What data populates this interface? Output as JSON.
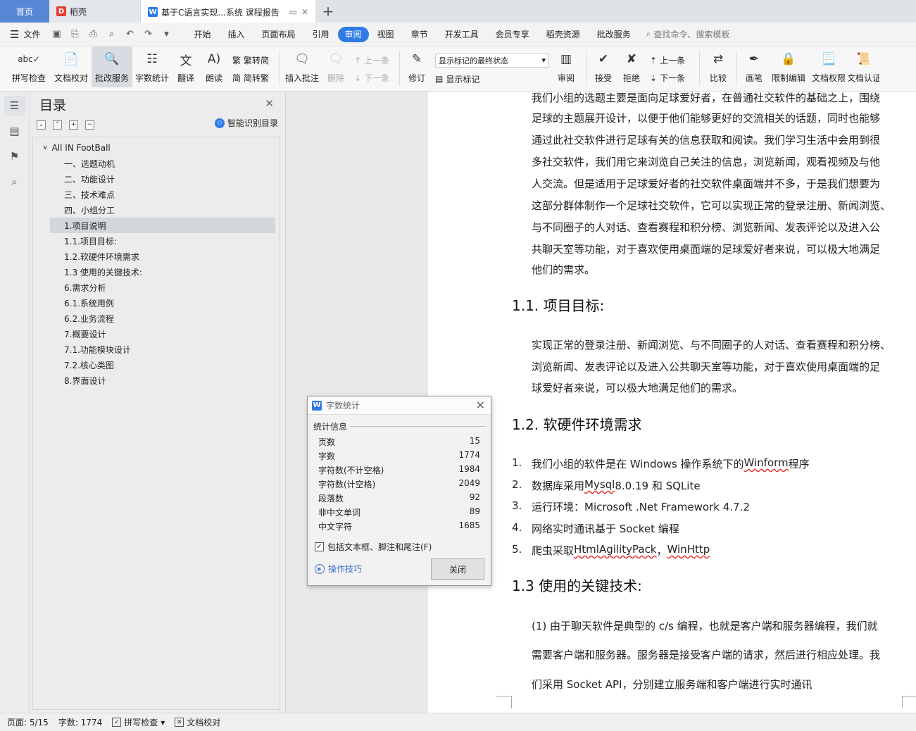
{
  "tabs": {
    "home": "首页",
    "daoke": "稻壳",
    "doc_title": "基于C语言实现...系统 课程报告",
    "add": "+"
  },
  "menubar": {
    "file": "文件",
    "items": [
      "开始",
      "插入",
      "页面布局",
      "引用",
      "审阅",
      "视图",
      "章节",
      "开发工具",
      "会员专享",
      "稻壳资源",
      "批改服务"
    ],
    "active": "审阅",
    "search": "查找命令、搜索模板"
  },
  "ribbon": {
    "spellcheck": "拼写检查",
    "doc_proof": "文档校对",
    "review_service": "批改服务",
    "word_count": "字数统计",
    "translate": "翻译",
    "read_aloud": "朗读",
    "trad_conv": "繁转简",
    "simp_conv": "简转繁",
    "insert_comment": "插入批注",
    "delete": "删除",
    "prev": "上一条",
    "next": "下一条",
    "track": "修订",
    "display_select": "显示标记的最终状态",
    "show_markup": "显示标记",
    "review": "审阅",
    "accept": "接受",
    "reject": "拒绝",
    "prev2": "上一条",
    "next2": "下一条",
    "compare": "比较",
    "pen": "画笔",
    "restrict": "限制编辑",
    "doc_perm": "文档权限",
    "doc_cert": "文档认证"
  },
  "toc": {
    "title": "目录",
    "smart": "智能识别目录",
    "root": "All IN FootBall",
    "items": [
      "一、选题动机",
      "二、功能设计",
      "三、技术难点",
      "四、小组分工",
      "1.项目说明",
      "1.1.项目目标:",
      "1.2.软硬件环境需求",
      "1.3 使用的关键技术:",
      "6.需求分析",
      "6.1.系统用例",
      "6.2.业务流程",
      "7.概要设计",
      "7.1.功能模块设计",
      "7.2.核心类图",
      "8.界面设计"
    ]
  },
  "doc": {
    "intro_lines": [
      "我们小组的选题主要是面向足球爱好者，在普通社交软件的基础之上，围绕",
      "足球的主题展开设计，以便于他们能够更好的交流相关的话题，同时也能够",
      "通过此社交软件进行足球有关的信息获取和阅读。我们学习生活中会用到很",
      "多社交软件，我们用它来浏览自己关注的信息，浏览新闻，观看视频及与他",
      "人交流。但是适用于足球爱好者的社交软件桌面端并不多，于是我们想要为",
      "这部分群体制作一个足球社交软件，它可以实现正常的登录注册、新闻浏览、",
      "与不同圈子的人对话、查看赛程和积分榜、浏览新闻、发表评论以及进入公",
      "共聊天室等功能，对于喜欢使用桌面端的足球爱好者来说，可以极大地满足",
      "他们的需求。"
    ],
    "h_goal": "1.1. 项目目标:",
    "goal_lines": [
      "实现正常的登录注册、新闻浏览、与不同圈子的人对话、查看赛程和积分榜、",
      "浏览新闻、发表评论以及进入公共聊天室等功能，对于喜欢使用桌面端的足",
      "球爱好者来说，可以极大地满足他们的需求。"
    ],
    "h_env": "1.2. 软硬件环境需求",
    "env": [
      {
        "n": "1.",
        "a": "我们小组的软件是在 Windows 操作系统下的 ",
        "w": "Winform",
        "b": " 程序"
      },
      {
        "n": "2.",
        "a": "数据库采用 ",
        "w": "Mysql",
        "b": " 8.0.19 和 SQLite"
      },
      {
        "n": "3.",
        "a": "运行环境：Microsoft .Net Framework 4.7.2",
        "w": "",
        "b": ""
      },
      {
        "n": "4.",
        "a": "网络实时通讯基于 Socket 编程",
        "w": "",
        "b": ""
      },
      {
        "n": "5.",
        "a": "爬虫采取 ",
        "w": "HtmlAgilityPack",
        "b": "，",
        "w2": "WinHttp"
      }
    ],
    "h_tech": "1.3 使用的关键技术:",
    "tech_lines": [
      "(1)  由于聊天软件是典型的 c/s 编程，也就是客户端和服务器编程，我们就",
      "需要客户端和服务器。服务器是接受客户端的请求，然后进行相应处理。我",
      "们采用 Socket API，分别建立服务端和客户端进行实时通讯"
    ]
  },
  "dialog": {
    "title": "字数统计",
    "group": "统计信息",
    "rows": [
      {
        "label": "页数",
        "value": "15"
      },
      {
        "label": "字数",
        "value": "1774"
      },
      {
        "label": "字符数(不计空格)",
        "value": "1984"
      },
      {
        "label": "字符数(计空格)",
        "value": "2049"
      },
      {
        "label": "段落数",
        "value": "92"
      },
      {
        "label": "非中文单词",
        "value": "89"
      },
      {
        "label": "中文字符",
        "value": "1685"
      }
    ],
    "checkbox": "包括文本框、脚注和尾注(F)",
    "tips": "操作技巧",
    "close": "关闭"
  },
  "status": {
    "page": "页面: 5/15",
    "words": "字数: 1774",
    "spell": "拼写检查",
    "proof": "文档校对"
  },
  "colors": {
    "accent": "#2f7be6",
    "home_tab": "#5a86d6",
    "daoke_red": "#e23d2e"
  }
}
